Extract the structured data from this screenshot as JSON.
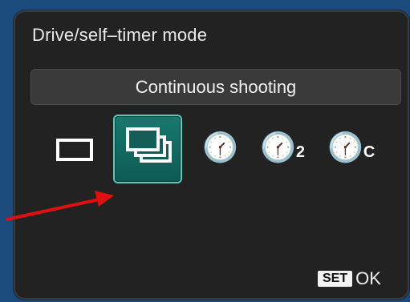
{
  "screen": {
    "title": "Drive/self–timer mode",
    "selected_mode_label": "Continuous shooting"
  },
  "options": [
    {
      "id": "single",
      "icon": "single-shot-icon",
      "selected": false
    },
    {
      "id": "continuous",
      "icon": "continuous-shooting-icon",
      "selected": true
    },
    {
      "id": "self-timer-10s",
      "icon": "self-timer-icon",
      "selected": false
    },
    {
      "id": "self-timer-2s",
      "icon": "self-timer-2s-icon",
      "sub_label": "2",
      "selected": false
    },
    {
      "id": "self-timer-continuous",
      "icon": "self-timer-continuous-icon",
      "sub_label": "C",
      "selected": false
    }
  ],
  "footer": {
    "set_label": "SET",
    "ok_label": "OK"
  },
  "annotation": {
    "color": "#e01010",
    "icon": "pointer-arrow"
  },
  "colors": {
    "background": "#1b4a7c",
    "screen": "#222222",
    "highlight": "#18786e"
  }
}
